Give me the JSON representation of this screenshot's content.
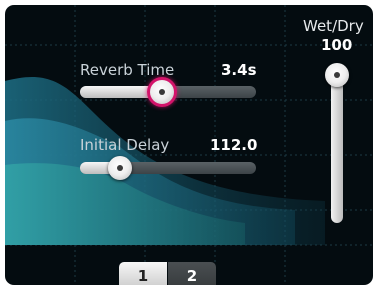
{
  "reverb_time": {
    "label": "Reverb Time",
    "value": "3.4s",
    "level": 0.52
  },
  "initial_delay": {
    "label": "Initial Delay",
    "value": "112.0",
    "level": 0.22
  },
  "wet_dry": {
    "label": "Wet/Dry",
    "value": "100",
    "level": 1.0
  },
  "pages": {
    "page1": "1",
    "page2": "2",
    "active": "1"
  },
  "colors": {
    "selected_ring": "#d3146a",
    "panel_bg": "#040c10",
    "curve_teal": "#1f6f86"
  }
}
